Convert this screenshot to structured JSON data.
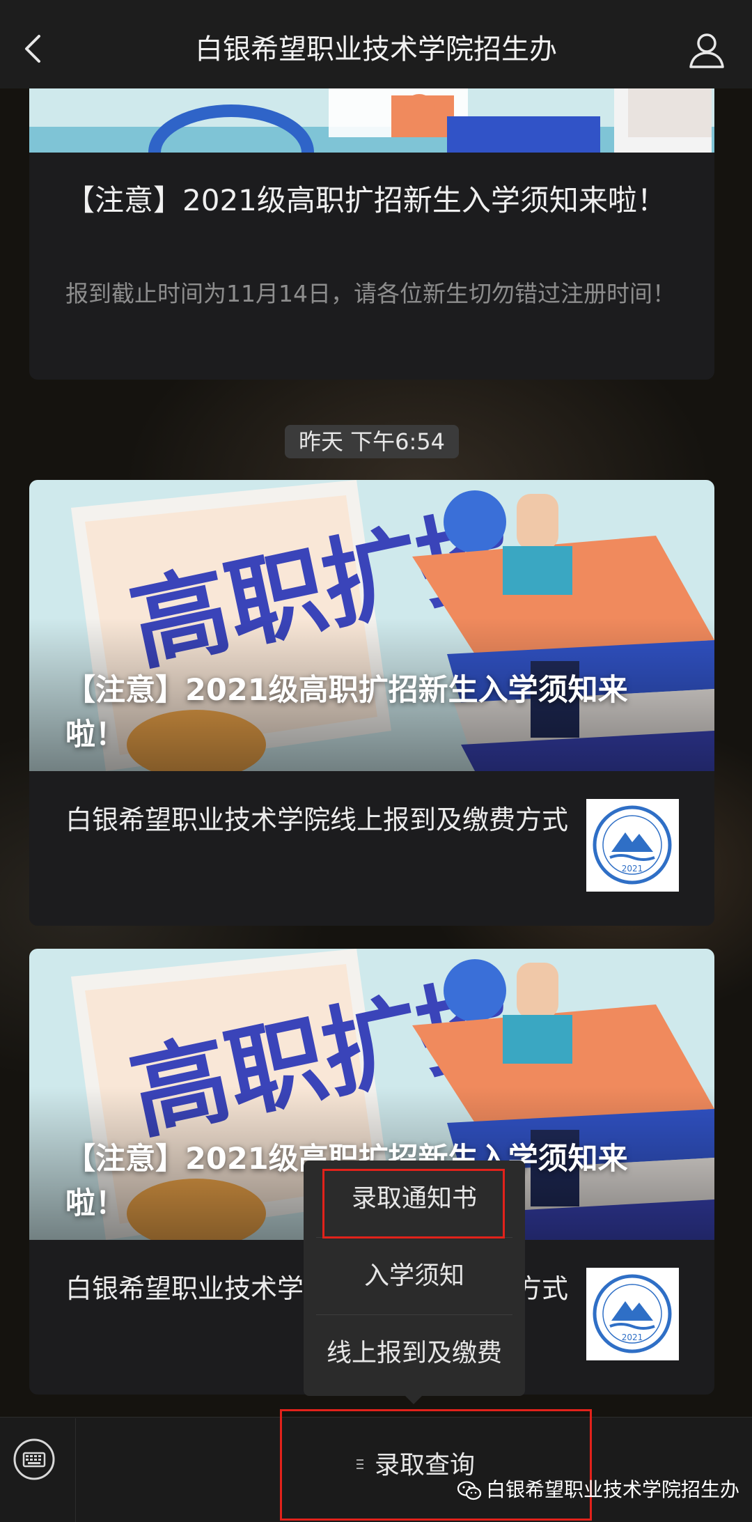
{
  "header": {
    "title": "白银希望职业技术学院招生办",
    "back_icon": "chevron-left-icon",
    "profile_icon": "person-icon"
  },
  "articles": [
    {
      "title": "【注意】2021级高职扩招新生入学须知来啦！",
      "description": "报到截止时间为11月14日，请各位新生切勿错过注册时间！"
    }
  ],
  "timestamp": "昨天 下午6:54",
  "multi_articles": [
    {
      "banner_title": "【注意】2021级高职扩招新生入学须知来啦！",
      "banner_text": "高职扩招",
      "sub_title": "白银希望职业技术学院线上报到及缴费方式",
      "thumb_text": "2021"
    },
    {
      "banner_title": "【注意】2021级高职扩招新生入学须知来啦！",
      "banner_text": "高职扩招",
      "sub_title": "白银希望职业技术学院线上报到及缴费方式",
      "thumb_text": "2021"
    }
  ],
  "popup_menu": {
    "items": [
      "录取通知书",
      "入学须知",
      "线上报到及缴费"
    ]
  },
  "bottom_bar": {
    "keyboard_icon": "keyboard-icon",
    "main_tab": "录取查询",
    "watermark": "白银希望职业技术学院招生办"
  },
  "colors": {
    "highlight": "#e2221b",
    "banner_sky": "#cfe9ec",
    "banner_orange": "#f08a5d"
  }
}
